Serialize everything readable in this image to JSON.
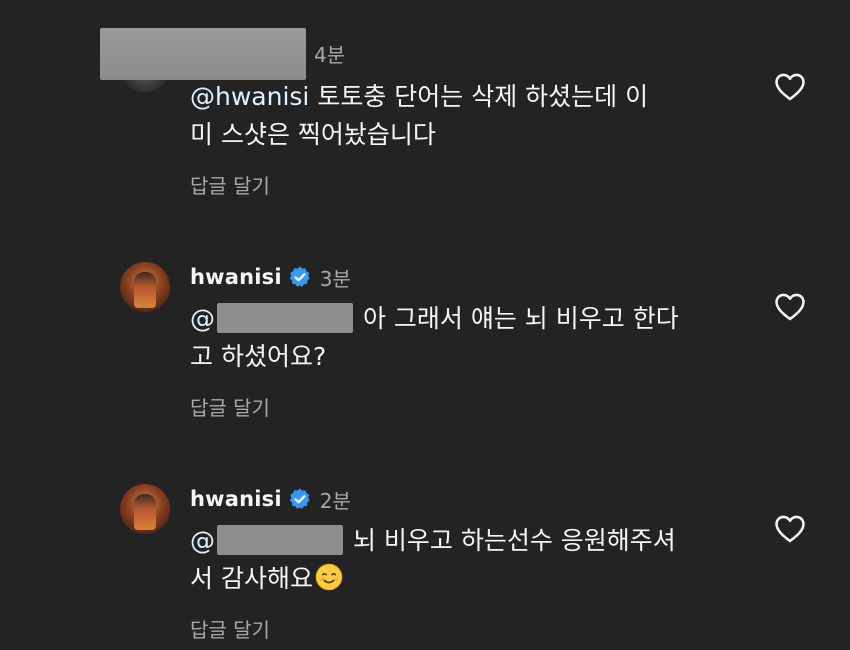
{
  "comments": [
    {
      "username": "",
      "time": "4분",
      "mention": "@hwanisi",
      "line1": " 토토충 단어는 삭제 하셨는데 이",
      "line2": "미 스샷은 찍어놨습니다",
      "reply_label": "답글 달기",
      "avatar_icon": "profile-avatar-icon",
      "heart_icon": "heart-outline-icon",
      "verified": false
    },
    {
      "username": "hwanisi",
      "time": "3분",
      "mention": "@",
      "line1": "아 그래서 얘는 뇌 비우고 한다",
      "line2": "고 하셨어요?",
      "reply_label": "답글 달기",
      "avatar_icon": "profile-avatar-icon",
      "heart_icon": "heart-outline-icon",
      "verified": true
    },
    {
      "username": "hwanisi",
      "time": "2분",
      "mention": "@",
      "line1": "뇌 비우고 하는선수 응원해주셔",
      "line2": "서 감사해요",
      "line2_emoji": "smiling-face-emoji",
      "reply_label": "답글 달기",
      "avatar_icon": "profile-avatar-icon",
      "heart_icon": "heart-outline-icon",
      "verified": true
    }
  ],
  "colors": {
    "background": "#232323",
    "primary_text": "#f5f5f5",
    "secondary_text": "#a8a8a8",
    "verified_badge": "#3897f0"
  }
}
